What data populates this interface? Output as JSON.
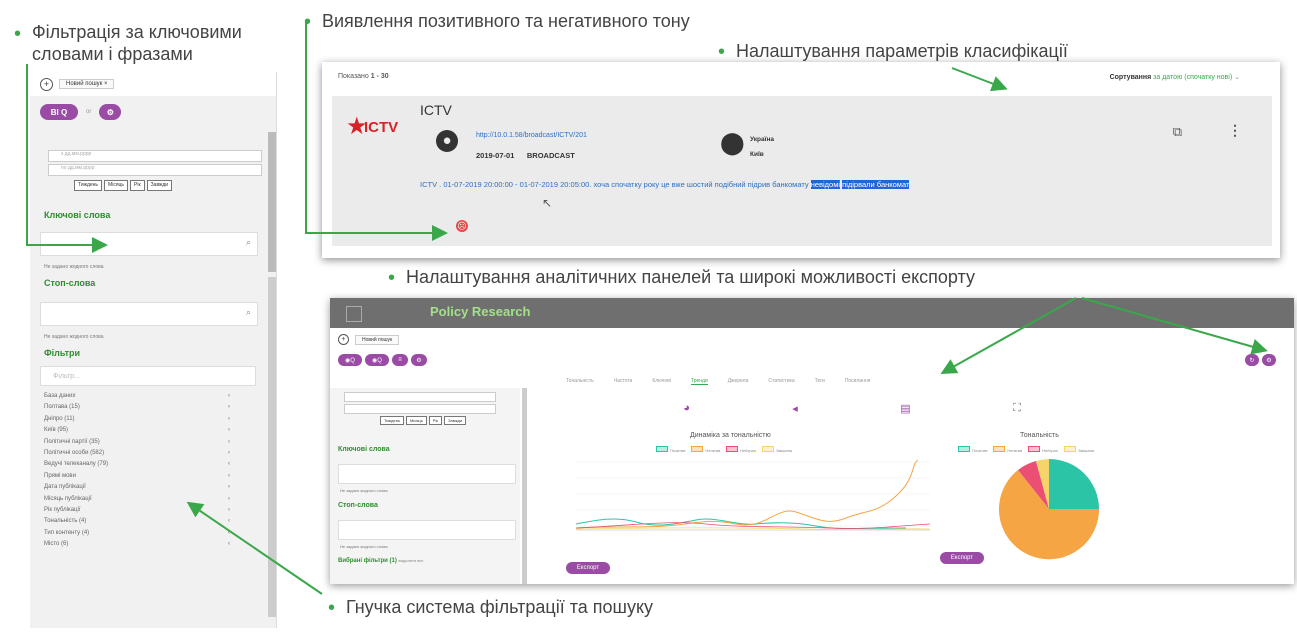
{
  "callouts": {
    "keywords_line1": "Фільтрація за ключовими",
    "keywords_line2": "словами і фразами",
    "tone": "Виявлення позитивного та негативного тону",
    "classification": "Налаштування параметрів класифікації",
    "analytics": "Налаштування аналітичних панелей та широкі можливості експорту",
    "filtering": "Гнучка система фільтрації та пошуку"
  },
  "left_panel": {
    "tab_label": "Новий пошук",
    "close_mark": "×",
    "pill_search": "BI Q",
    "pill_sep": "or",
    "pill_icon": "⚙",
    "date_from": "з     дд.мм.рррр",
    "date_to": "по   дд.мм.рррр",
    "date_buttons": [
      "Тиждень",
      "Місяць",
      "Рік",
      "Завжди"
    ],
    "keywords_heading": "Ключові слова",
    "keywords_note": "Не задано жодного слова",
    "stopwords_heading": "Стоп-слова",
    "stopwords_note": "Не задано жодного слова",
    "filters_heading": "Фільтри",
    "filter_placeholder": "Фільтр...",
    "filter_items": [
      "База даних",
      "Полтава (15)",
      "Дніпро (11)",
      "Київ (95)",
      "Політичні партії (35)",
      "Політичні особи (582)",
      "Ведучі телеканалу (79)",
      "Прямі мови",
      "Дата публікації",
      "Місяць публікації",
      "Рік публікації",
      "Тональність (4)",
      "Тип контенту (4)",
      "Місто (6)"
    ]
  },
  "result_card": {
    "shown_prefix": "Показано",
    "shown_range": "1 - 30",
    "sort_label": "Сортування",
    "sort_value": "за датою (спочатку нові)",
    "source_title": "ICTV",
    "logo_text": "ICTV",
    "url": "http://10.0.1.58/broadcast/ICTV/201",
    "date": "2019-07-01",
    "type": "BROADCAST",
    "country": "Україна",
    "city": "Київ",
    "text_prefix": "ICTV . 01-07-2019 20:00:00 - 01-07-2019 20:05:00. хоча спочатку року це вже шостий подібний підрив банкомату",
    "highlight1": "невідомі",
    "highlight2": "підірвали банкомат"
  },
  "dashboard": {
    "brand": "Policy Research",
    "tab_label": "Новий пошук",
    "tabs": [
      "Тональність",
      "Частота",
      "Ключові",
      "Тренди",
      "Джерела",
      "Статистика",
      "Теги",
      "Посилання"
    ],
    "date_buttons": [
      "Тиждень",
      "Місяць",
      "Рік",
      "Завжди"
    ],
    "keywords_heading": "Ключові слова",
    "stopwords_heading": "Стоп-слова",
    "selected_filters": "Вибрані фільтри (1)",
    "clear_filters": "видалити все",
    "note": "Не задано жодного слова",
    "export_label": "Експорт",
    "line_title": "Динаміка за тональністю",
    "pie_title": "Тональність",
    "legend": [
      "Позитив",
      "Негатив",
      "Нейтрал",
      "Змішана"
    ]
  },
  "colors": {
    "accent_purple": "#9a4ca5",
    "green": "#3aa84a",
    "highlight_blue": "#1e66d9",
    "pie_orange": "#f5a544",
    "pie_teal": "#2cc4a6",
    "pie_pink": "#ec4f74",
    "pie_yellow": "#f5d56a"
  }
}
